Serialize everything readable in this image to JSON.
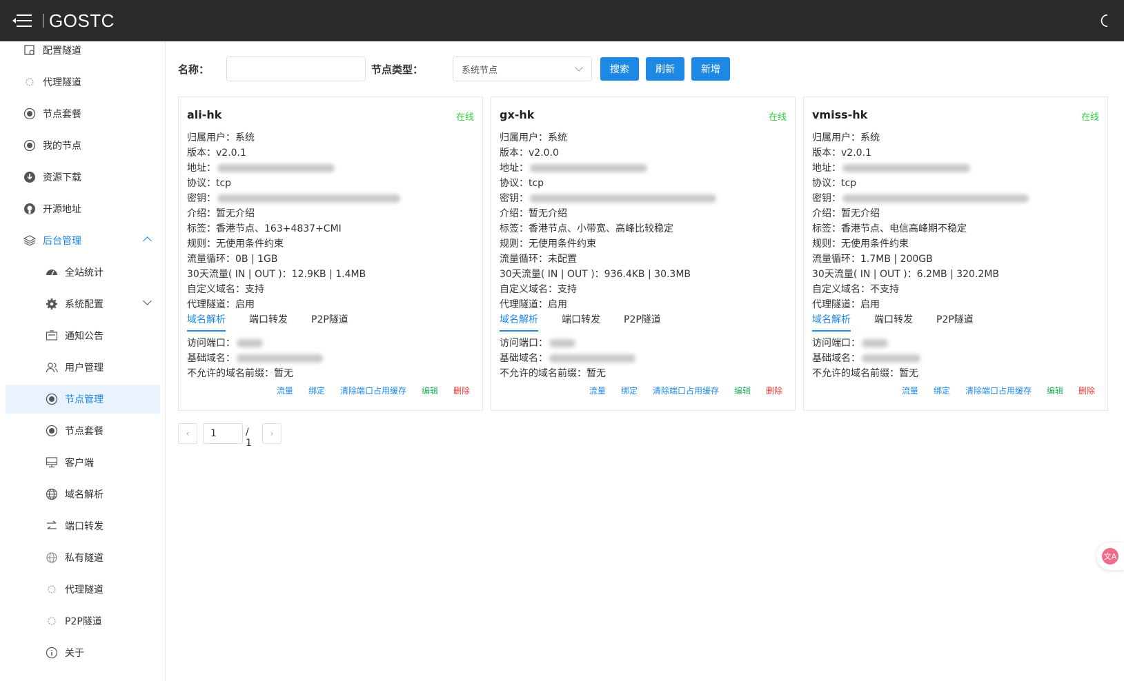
{
  "app": {
    "brand": "GOSTC"
  },
  "sidebar": {
    "items": [
      {
        "label": "配置隧道",
        "icon": "config-tunnel-icon"
      },
      {
        "label": "代理隧道",
        "icon": "proxy-icon"
      },
      {
        "label": "节点套餐",
        "icon": "package-icon"
      },
      {
        "label": "我的节点",
        "icon": "node-icon"
      },
      {
        "label": "资源下载",
        "icon": "download-icon"
      },
      {
        "label": "开源地址",
        "icon": "github-icon"
      },
      {
        "label": "后台管理",
        "icon": "layers-icon"
      },
      {
        "label": "全站统计",
        "icon": "dashboard-icon"
      },
      {
        "label": "系统配置",
        "icon": "gear-icon"
      },
      {
        "label": "通知公告",
        "icon": "notice-icon"
      },
      {
        "label": "用户管理",
        "icon": "users-icon"
      },
      {
        "label": "节点管理",
        "icon": "node-icon"
      },
      {
        "label": "节点套餐",
        "icon": "package-icon"
      },
      {
        "label": "客户端",
        "icon": "monitor-icon"
      },
      {
        "label": "域名解析",
        "icon": "globe-icon"
      },
      {
        "label": "端口转发",
        "icon": "swap-icon"
      },
      {
        "label": "私有隧道",
        "icon": "private-globe-icon"
      },
      {
        "label": "代理隧道",
        "icon": "proxy-icon"
      },
      {
        "label": "P2P隧道",
        "icon": "p2p-icon"
      },
      {
        "label": "关于",
        "icon": "info-icon"
      }
    ]
  },
  "filter": {
    "name_label": "名称：",
    "name_value": "",
    "type_label": "节点类型：",
    "type_value": "系统节点",
    "search_label": "搜索",
    "refresh_label": "刷新",
    "add_label": "新增"
  },
  "cards": [
    {
      "name": "ali-hk",
      "status": "在线",
      "owner": "归属用户：系统",
      "version": "版本：v2.0.1",
      "address_label": "地址：",
      "protocol": "协议：tcp",
      "secret_label": "密钥：",
      "intro": "介绍：暂无介绍",
      "tags": "标签：香港节点、163+4837+CMI",
      "rules": "规则：无使用条件约束",
      "cycle": "流量循环：0B | 1GB",
      "traffic": "30天流量( IN | OUT )：12.9KB | 1.4MB",
      "custom_domain": "自定义域名：支持",
      "proxy_tunnel": "代理隧道：启用",
      "tabs": [
        "域名解析",
        "端口转发",
        "P2P隧道"
      ],
      "access_port_label": "访问端口：",
      "base_domain_label": "基础域名：",
      "forbidden_prefix": "不允许的域名前缀：暂无",
      "actions": [
        "流量",
        "绑定",
        "清除端口占用缓存",
        "编辑",
        "删除"
      ]
    },
    {
      "name": "gx-hk",
      "status": "在线",
      "owner": "归属用户：系统",
      "version": "版本：v2.0.0",
      "address_label": "地址：",
      "protocol": "协议：tcp",
      "secret_label": "密钥：",
      "intro": "介绍：暂无介绍",
      "tags": "标签：香港节点、小带宽、高峰比较稳定",
      "rules": "规则：无使用条件约束",
      "cycle": "流量循环：未配置",
      "traffic": "30天流量( IN | OUT )：936.4KB | 30.3MB",
      "custom_domain": "自定义域名：支持",
      "proxy_tunnel": "代理隧道：启用",
      "tabs": [
        "域名解析",
        "端口转发",
        "P2P隧道"
      ],
      "access_port_label": "访问端口：",
      "base_domain_label": "基础域名：",
      "forbidden_prefix": "不允许的域名前缀：暂无",
      "actions": [
        "流量",
        "绑定",
        "清除端口占用缓存",
        "编辑",
        "删除"
      ]
    },
    {
      "name": "vmiss-hk",
      "status": "在线",
      "owner": "归属用户：系统",
      "version": "版本：v2.0.1",
      "address_label": "地址：",
      "protocol": "协议：tcp",
      "secret_label": "密钥：",
      "intro": "介绍：暂无介绍",
      "tags": "标签：香港节点、电信高峰期不稳定",
      "rules": "规则：无使用条件约束",
      "cycle": "流量循环：1.7MB | 200GB",
      "traffic": "30天流量( IN | OUT )：6.2MB | 320.2MB",
      "custom_domain": "自定义域名：不支持",
      "proxy_tunnel": "代理隧道：启用",
      "tabs": [
        "域名解析",
        "端口转发",
        "P2P隧道"
      ],
      "access_port_label": "访问端口：",
      "base_domain_label": "基础域名：",
      "forbidden_prefix": "不允许的域名前缀：暂无",
      "actions": [
        "流量",
        "绑定",
        "清除端口占用缓存",
        "编辑",
        "删除"
      ]
    }
  ],
  "pagination": {
    "page": "1",
    "total": "/ 1"
  },
  "colors": {
    "accent": "#1e88e5",
    "online": "#2ecc40",
    "topbar": "#2b2b2b",
    "danger": "#e53935",
    "edit": "#27ae60"
  }
}
